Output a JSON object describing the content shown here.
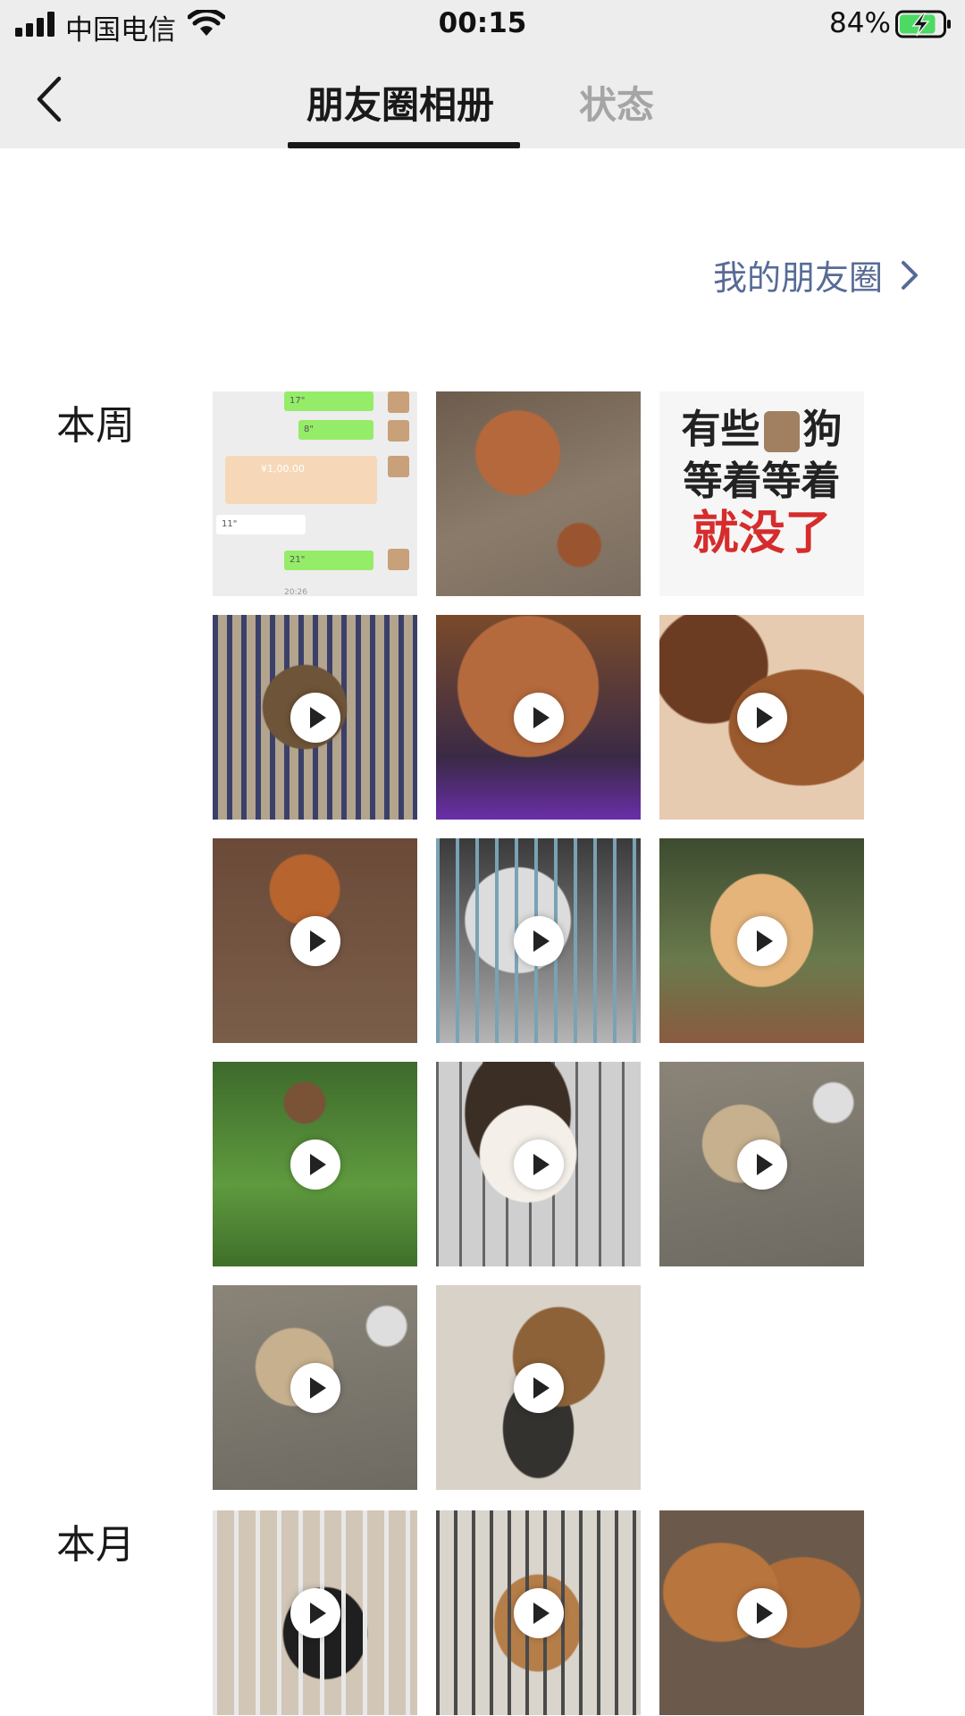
{
  "status_bar": {
    "carrier": "中国电信",
    "time": "00:15",
    "battery_percent": "84%",
    "battery_level": 0.84,
    "charging": true
  },
  "nav": {
    "tabs": [
      {
        "label": "朋友圈相册",
        "active": true
      },
      {
        "label": "状态",
        "active": false
      }
    ]
  },
  "my_moments_link": "我的朋友圈",
  "sections": [
    {
      "label": "本周",
      "items": [
        {
          "kind": "image",
          "subject": "chat-screenshot",
          "video": false
        },
        {
          "kind": "image",
          "subject": "puppies",
          "video": false
        },
        {
          "kind": "image",
          "subject": "meme",
          "video": false,
          "text": [
            "有些",
            "狗",
            "等着等着",
            "就没了"
          ]
        },
        {
          "kind": "video",
          "subject": "dog-in-cage",
          "video": true
        },
        {
          "kind": "video",
          "subject": "poodle",
          "video": true
        },
        {
          "kind": "video",
          "subject": "puppy-closeup",
          "video": true
        },
        {
          "kind": "video",
          "subject": "puppies-ground",
          "video": true
        },
        {
          "kind": "video",
          "subject": "husky-cage",
          "video": true
        },
        {
          "kind": "video",
          "subject": "tiger",
          "video": true
        },
        {
          "kind": "video",
          "subject": "dog-grass",
          "video": true
        },
        {
          "kind": "video",
          "subject": "corgi",
          "video": true
        },
        {
          "kind": "video",
          "subject": "dog-floor",
          "video": true
        },
        {
          "kind": "video",
          "subject": "dog-floor",
          "video": true
        },
        {
          "kind": "video",
          "subject": "shepherd",
          "video": true
        }
      ]
    },
    {
      "label": "本月",
      "items": [
        {
          "kind": "video",
          "subject": "cat-cage",
          "video": true
        },
        {
          "kind": "video",
          "subject": "puppy-cage",
          "video": true
        },
        {
          "kind": "video",
          "subject": "puppies-bowl",
          "video": true
        }
      ]
    }
  ],
  "chat_screenshot": {
    "bubbles": [
      "17\"",
      "8\"",
      "¥1,00.00",
      "11\"",
      "21\""
    ],
    "time": "20:26"
  },
  "colors": {
    "link": "#576b95",
    "active_tab": "#191919",
    "inactive_tab": "#a5a5a5",
    "header_bg": "#ededed",
    "battery_charging": "#4cd964"
  }
}
